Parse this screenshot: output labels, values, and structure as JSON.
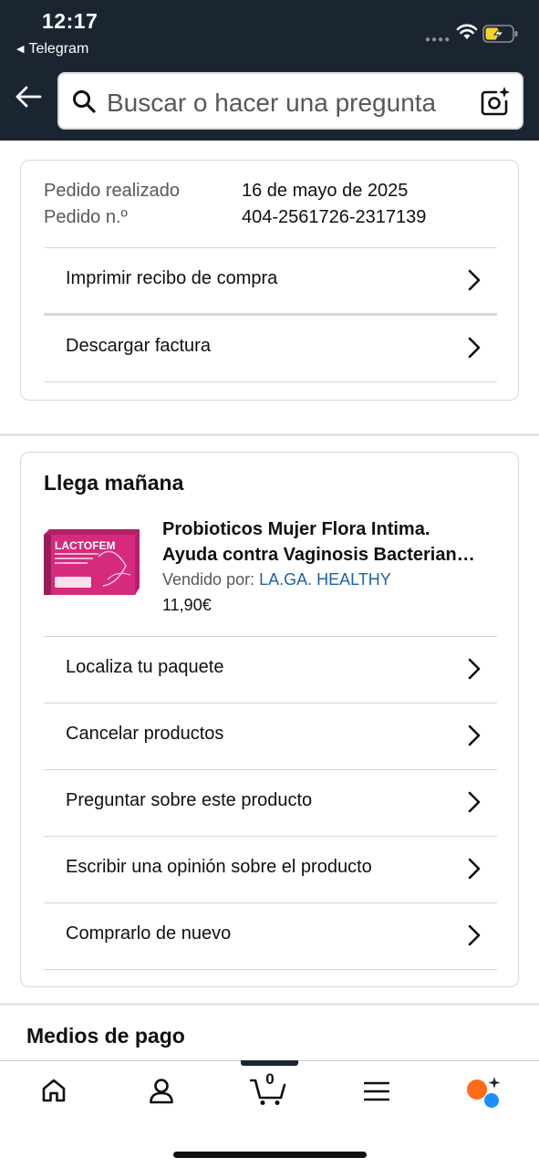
{
  "status_bar": {
    "time": "12:17",
    "back_app": "Telegram"
  },
  "search": {
    "placeholder": "Buscar o hacer una pregunta"
  },
  "order": {
    "placed_label": "Pedido realizado",
    "placed_value": "16 de mayo de 2025",
    "number_label": "Pedido n.º",
    "number_value": "404-2561726-2317139",
    "actions": [
      {
        "label": "Imprimir recibo de compra"
      },
      {
        "label": "Descargar factura"
      }
    ]
  },
  "shipment": {
    "title": "Llega mañana",
    "product": {
      "image_text": "LACTOFEM",
      "title_line1": "Probioticos Mujer Flora Intima.",
      "title_line2": "Ayuda contra Vaginosis Bacterian…",
      "sold_by_label": "Vendido por: ",
      "seller": "LA.GA. HEALTHY",
      "price": "11,90€"
    },
    "actions": [
      {
        "label": "Localiza tu paquete"
      },
      {
        "label": "Cancelar productos"
      },
      {
        "label": "Preguntar sobre este producto"
      },
      {
        "label": "Escribir una opinión sobre el producto"
      },
      {
        "label": "Comprarlo de nuevo"
      }
    ]
  },
  "payment": {
    "title": "Medios de pago"
  },
  "bottom_nav": {
    "items": [
      {
        "name": "home-icon"
      },
      {
        "name": "account-icon"
      },
      {
        "name": "cart-icon",
        "count": "0"
      },
      {
        "name": "menu-icon"
      },
      {
        "name": "rufus-assistant-icon"
      }
    ],
    "active_index": 2
  },
  "colors": {
    "header_bg": "#1b2532",
    "link": "#2162a1",
    "divider": "#d5d9d9"
  }
}
